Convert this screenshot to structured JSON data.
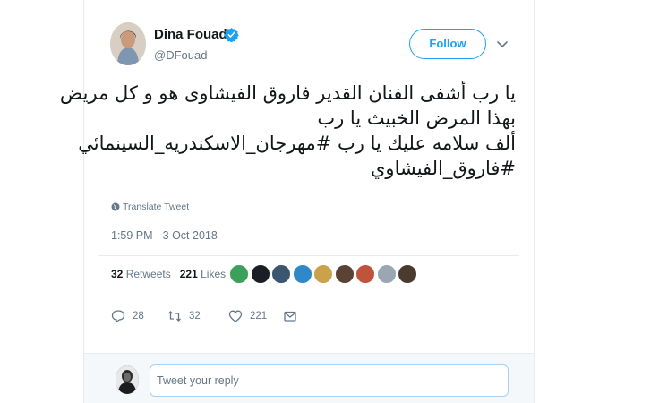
{
  "author": {
    "name": "Dina Fouad",
    "handle": "@DFouad",
    "verified": true
  },
  "follow_button": {
    "label": "Follow"
  },
  "tweet": {
    "lines": [
      "يا رب أشفى الفنان القدير فاروق الفيشاوى هو و كل مريض",
      "بهذا المرض الخبيث يا رب",
      "ألف سلامه عليك يا رب  #مهرجان_الاسكندريه_السينمائي",
      "#فاروق_الفيشاوي"
    ],
    "translate_label": "Translate Tweet",
    "timestamp": "1:59 PM - 3 Oct 2018"
  },
  "stats": {
    "retweets_count": "32",
    "retweets_label": "Retweets",
    "likes_count": "221",
    "likes_label": "Likes"
  },
  "liker_avatars": [
    {
      "name": "liker-avatar-1",
      "color": "#3aa05a"
    },
    {
      "name": "liker-avatar-2",
      "color": "#1a1f25"
    },
    {
      "name": "liker-avatar-3",
      "color": "#3c5670"
    },
    {
      "name": "liker-avatar-4",
      "color": "#2f88c8"
    },
    {
      "name": "liker-avatar-5",
      "color": "#c9a24b"
    },
    {
      "name": "liker-avatar-6",
      "color": "#5a4334"
    },
    {
      "name": "liker-avatar-7",
      "color": "#c0533c"
    },
    {
      "name": "liker-avatar-8",
      "color": "#9aa6b1"
    },
    {
      "name": "liker-avatar-9",
      "color": "#4a3b2e"
    }
  ],
  "actions": {
    "reply_count": "28",
    "retweet_count": "32",
    "like_count": "221"
  },
  "reply_box": {
    "placeholder": "Tweet your reply"
  },
  "colors": {
    "accent": "#1da1f2",
    "muted": "#657786",
    "border": "#e6ecf0"
  }
}
